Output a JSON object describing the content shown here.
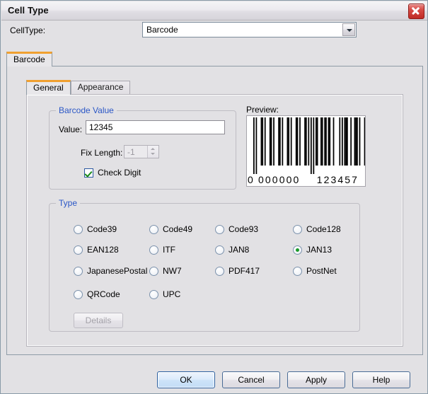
{
  "window": {
    "title": "Cell Type",
    "close_icon": "close-icon"
  },
  "celltype": {
    "label": "CellType:",
    "value": "Barcode",
    "dropdown_icon": "chevron-down-icon"
  },
  "outer_tabs": [
    {
      "label": "Barcode",
      "active": true
    }
  ],
  "inner_tabs": [
    {
      "label": "General",
      "active": true
    },
    {
      "label": "Appearance",
      "active": false
    }
  ],
  "barcode_value_group": {
    "title": "Barcode Value",
    "value_label": "Value:",
    "value": "12345",
    "value_placeholder": "",
    "fix_length_label": "Fix Length:",
    "fix_length_value": "-1",
    "fix_length_enabled": false,
    "check_digit_label": "Check Digit",
    "check_digit_checked": true
  },
  "preview": {
    "label": "Preview:",
    "human_readable": "0 000000 123457",
    "digits_left": "0",
    "digits_group1": "000000",
    "digits_group2": "123457"
  },
  "type_group": {
    "title": "Type",
    "selected": "JAN13",
    "options": [
      {
        "label": "Code39"
      },
      {
        "label": "Code49"
      },
      {
        "label": "Code93"
      },
      {
        "label": "Code128"
      },
      {
        "label": "EAN128"
      },
      {
        "label": "ITF"
      },
      {
        "label": "JAN8"
      },
      {
        "label": "JAN13"
      },
      {
        "label": "JapanesePostal"
      },
      {
        "label": "NW7"
      },
      {
        "label": "PDF417"
      },
      {
        "label": "PostNet"
      },
      {
        "label": "QRCode"
      },
      {
        "label": "UPC"
      }
    ],
    "details_label": "Details",
    "details_enabled": false
  },
  "footer_buttons": [
    {
      "label": "OK",
      "default": true
    },
    {
      "label": "Cancel",
      "default": false
    },
    {
      "label": "Apply",
      "default": false
    },
    {
      "label": "Help",
      "default": false
    }
  ],
  "colors": {
    "dialog_background": "#e2e1e4",
    "active_tab_accent": "#f0a030",
    "group_title": "#2b57c6",
    "radio_selected": "#1a9a2a",
    "check_mark": "#1a8a1a",
    "close_button": "#bf2a24",
    "default_button": "#cde3f8"
  }
}
